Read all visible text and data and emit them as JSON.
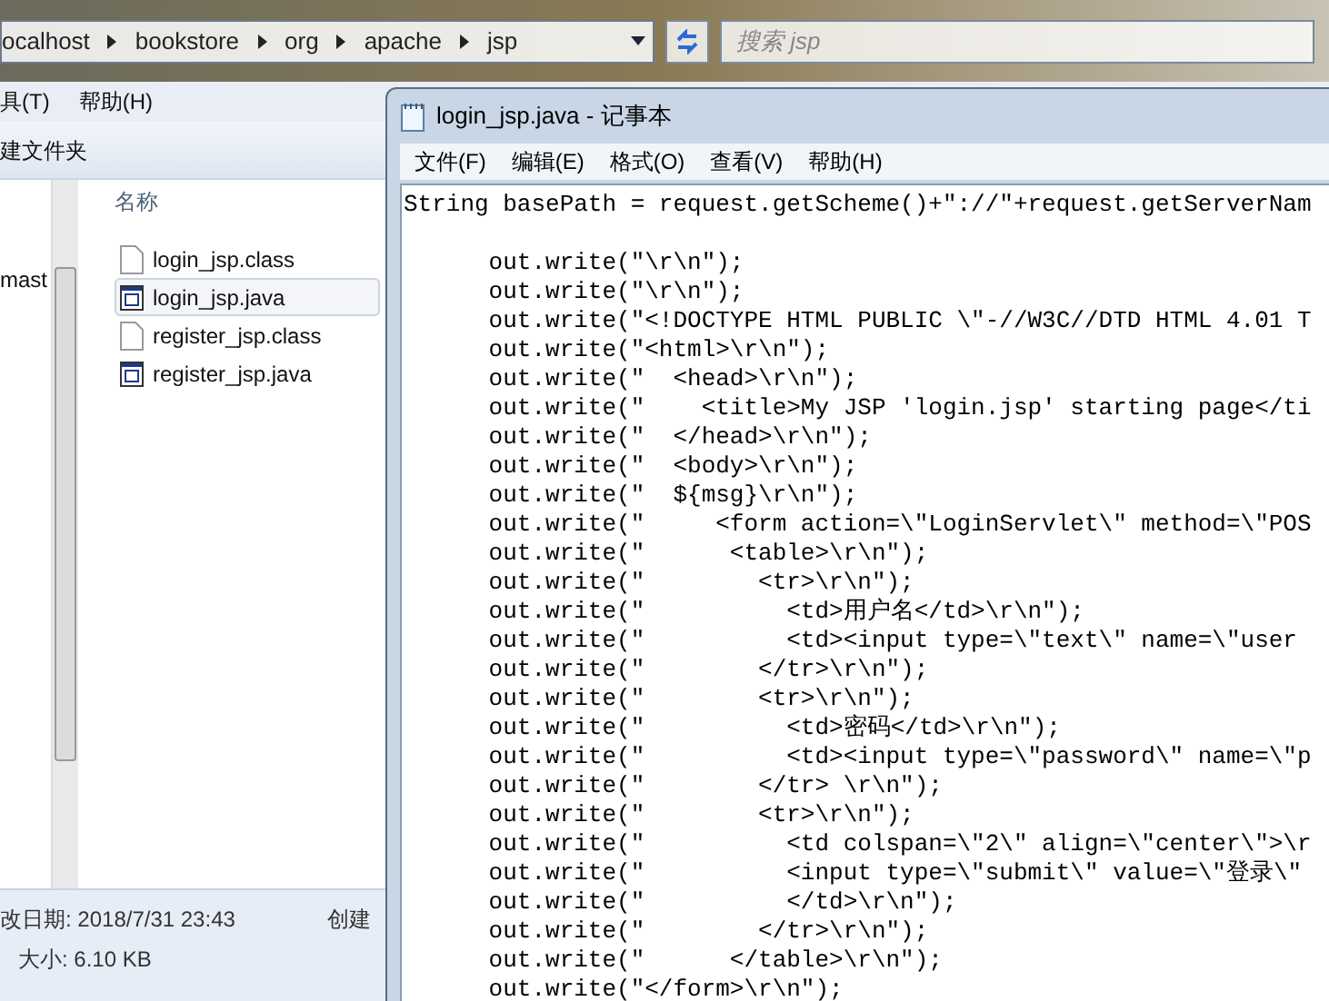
{
  "explorer": {
    "address_segments": [
      "ocalhost",
      "bookstore",
      "org",
      "apache",
      "jsp"
    ],
    "search": {
      "placeholder": "搜索 jsp"
    },
    "menu": [
      "具(T)",
      "帮助(H)"
    ],
    "toolbar": [
      "建文件夹"
    ],
    "nav_items": [
      "mast"
    ],
    "column_header": "名称",
    "files": [
      {
        "name": "login_jsp.class",
        "kind": "class",
        "selected": false
      },
      {
        "name": "login_jsp.java",
        "kind": "java",
        "selected": true
      },
      {
        "name": "register_jsp.class",
        "kind": "class",
        "selected": false
      },
      {
        "name": "register_jsp.java",
        "kind": "java",
        "selected": false
      }
    ],
    "details": [
      "改日期: 2018/7/31 23:43",
      "大小: 6.10 KB"
    ],
    "details_side": "创建"
  },
  "notepad": {
    "title": "login_jsp.java - 记事本",
    "menu": [
      "文件(F)",
      "编辑(E)",
      "格式(O)",
      "查看(V)",
      "帮助(H)"
    ],
    "first_line": "String basePath = request.getScheme()+\"://\"+request.getServerNam",
    "lines": [
      "      out.write(\"\\r\\n\");",
      "      out.write(\"\\r\\n\");",
      "      out.write(\"<!DOCTYPE HTML PUBLIC \\\"-//W3C//DTD HTML 4.01 T",
      "      out.write(\"<html>\\r\\n\");",
      "      out.write(\"  <head>\\r\\n\");",
      "      out.write(\"    <title>My JSP 'login.jsp' starting page</ti",
      "      out.write(\"  </head>\\r\\n\");",
      "      out.write(\"  <body>\\r\\n\");",
      "      out.write(\"  ${msg}\\r\\n\");",
      "      out.write(\"     <form action=\\\"LoginServlet\\\" method=\\\"POS",
      "      out.write(\"      <table>\\r\\n\");",
      "      out.write(\"        <tr>\\r\\n\");",
      "      out.write(\"          <td>用户名</td>\\r\\n\");",
      "      out.write(\"          <td><input type=\\\"text\\\" name=\\\"user",
      "      out.write(\"        </tr>\\r\\n\");",
      "      out.write(\"        <tr>\\r\\n\");",
      "      out.write(\"          <td>密码</td>\\r\\n\");",
      "      out.write(\"          <td><input type=\\\"password\\\" name=\\\"p",
      "      out.write(\"        </tr> \\r\\n\");",
      "      out.write(\"        <tr>\\r\\n\");",
      "      out.write(\"          <td colspan=\\\"2\\\" align=\\\"center\\\">\\r",
      "      out.write(\"          <input type=\\\"submit\\\" value=\\\"登录\\\"",
      "      out.write(\"          </td>\\r\\n\");",
      "      out.write(\"        </tr>\\r\\n\");",
      "      out.write(\"      </table>\\r\\n\");",
      "      out.write(\"</form>\\r\\n\");"
    ]
  }
}
